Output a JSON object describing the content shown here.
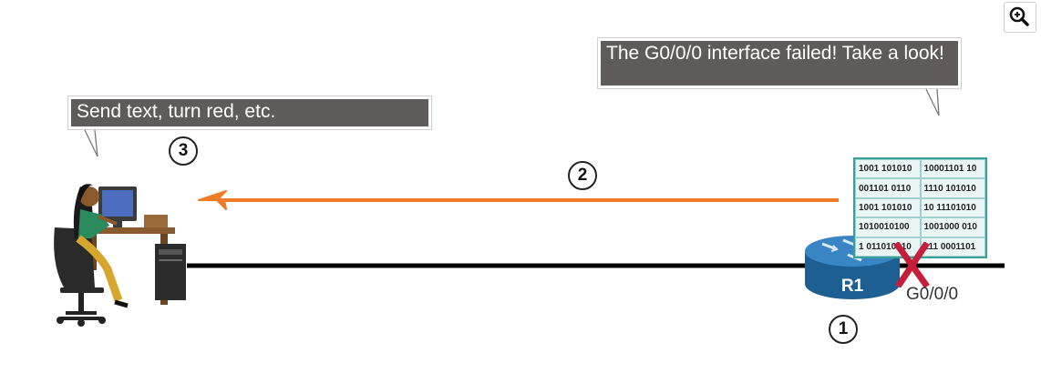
{
  "callouts": {
    "left": "Send text, turn red, etc.",
    "right": "The G0/0/0 interface failed! Take a look!"
  },
  "steps": {
    "one": "1",
    "two": "2",
    "three": "3"
  },
  "router": {
    "label": "R1",
    "interface": "G0/0/0"
  },
  "binary_table": {
    "rows": [
      [
        "1001 101010",
        "10001101 10"
      ],
      [
        "001101 0110",
        "1110 101010"
      ],
      [
        "1001 101010",
        "10 11101010"
      ],
      [
        "1010010100",
        "1001000 010"
      ],
      [
        "1 011010010",
        "111 0001101"
      ]
    ]
  },
  "colors": {
    "arrow": "#ee7c27",
    "failure_mark": "#c41e3a",
    "router_body": "#2a6fa8",
    "callout_fill": "#5f5b5b",
    "link": "#000000"
  },
  "icons": {
    "zoom": "zoom-in-icon",
    "workstation": "user-at-computer-icon",
    "router": "router-icon",
    "failure": "x-mark-icon"
  }
}
